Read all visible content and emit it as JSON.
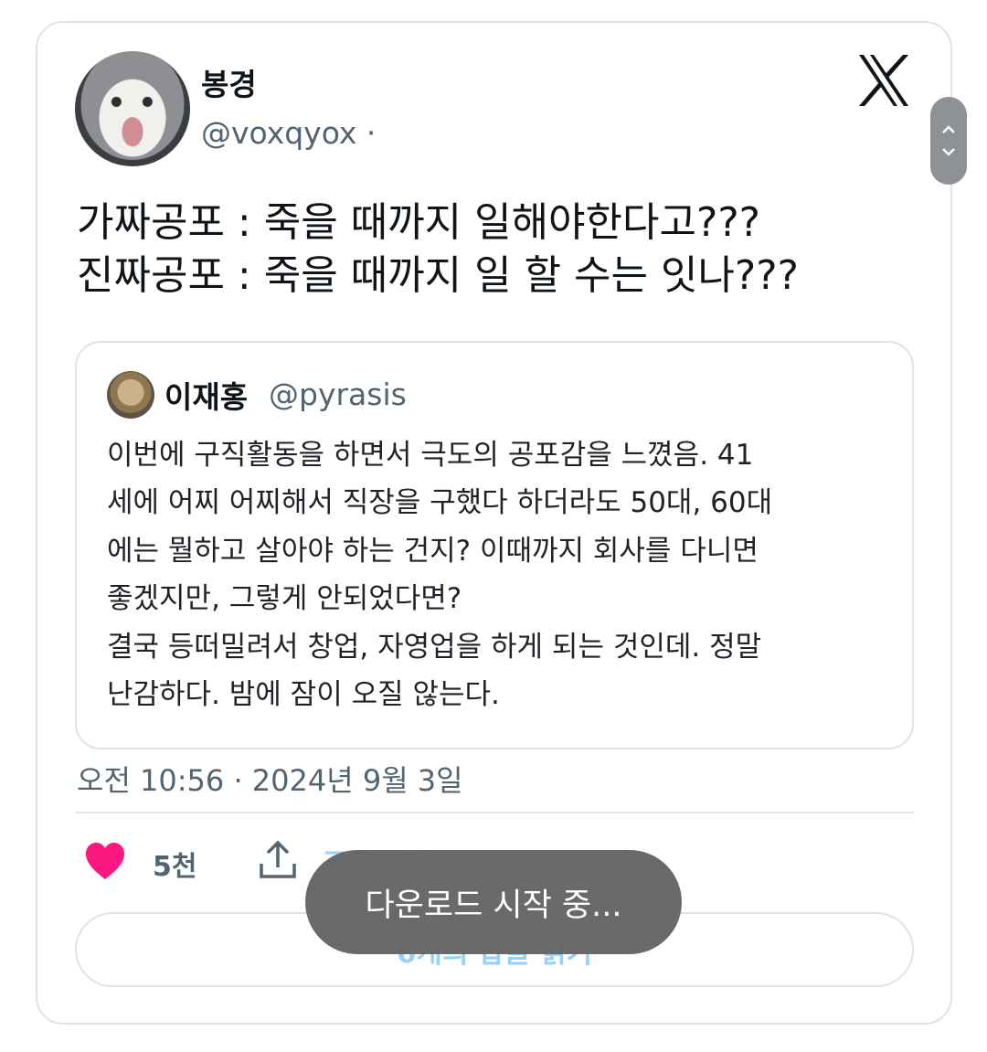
{
  "tweet": {
    "display_name": "봉경",
    "handle": "@voxqyox ·",
    "text": "가짜공포 : 죽을 때까지 일해야한다고???\n진짜공포 : 죽을 때까지 일 할 수는 잇나???",
    "timestamp": "오전 10:56 · 2024년 9월 3일",
    "like_count": "5천",
    "share_label": "공유하기",
    "replies_label": "6개의 답글 읽기",
    "avatar_icon": "cat-avatar",
    "brand_icon": "x-logo-icon"
  },
  "quoted_tweet": {
    "display_name": "이재홍",
    "handle": "@pyrasis",
    "text": "이번에 구직활동을 하면서 극도의 공포감을 느꼈음. 41\n세에 어찌 어찌해서 직장을 구했다 하더라도 50대, 60대\n에는 뭘하고 살아야 하는 건지? 이때까지 회사를 다니면\n좋겠지만, 그렇게 안되었다면?\n결국 등떠밀려서 창업, 자영업을 하게 되는 것인데. 정말\n난감하다. 밤에 잠이 오질 않는다."
  },
  "toast": {
    "text": "다운로드 시작 중..."
  },
  "colors": {
    "accent": "#1d9bf0",
    "heart": "#f91880",
    "secondary_text": "#536471"
  }
}
